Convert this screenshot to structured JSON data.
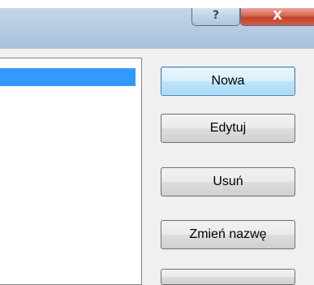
{
  "titlebar": {
    "help_glyph": "?",
    "close_glyph": "X"
  },
  "buttons": {
    "new_label": "Nowa",
    "edit_label": "Edytuj",
    "delete_label": "Usuń",
    "rename_label": "Zmień nazwę"
  },
  "colors": {
    "selection": "#3399ff",
    "default_button_border": "#3c7fb1",
    "close_button": "#c2412a"
  }
}
